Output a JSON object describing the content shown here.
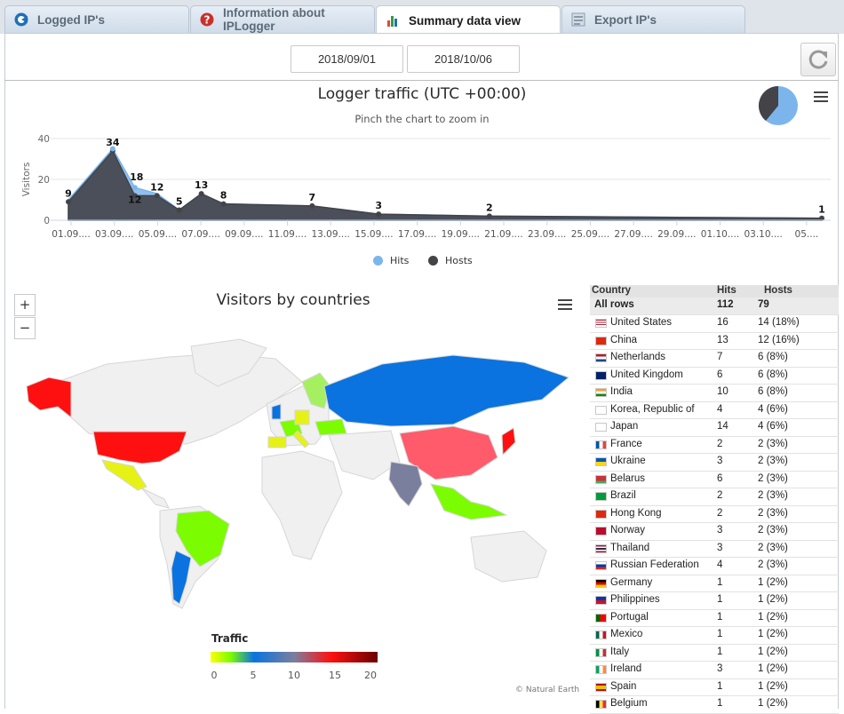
{
  "tabs": [
    {
      "label": "Logged IP's",
      "icon": "logged-ips-icon"
    },
    {
      "label": "Information about IPLogger",
      "icon": "info-icon"
    },
    {
      "label": "Summary data view",
      "icon": "bar-chart-icon"
    },
    {
      "label": "Export IP's",
      "icon": "export-icon"
    }
  ],
  "dates": {
    "from": "2018/09/01",
    "to": "2018/10/06"
  },
  "traffic": {
    "title": "Logger traffic (UTC +00:00)",
    "subtitle": "Pinch the chart to zoom in",
    "ylabel": "Visitors",
    "legend": [
      {
        "name": "Hits",
        "color": "#7cb5ec"
      },
      {
        "name": "Hosts",
        "color": "#434348"
      }
    ]
  },
  "chart_data": {
    "type": "area",
    "title": "Logger traffic (UTC +00:00)",
    "subtitle": "Pinch the chart to zoom in",
    "ylabel": "Visitors",
    "ylim": [
      0,
      40
    ],
    "yticks": [
      0,
      20,
      40
    ],
    "xticks": [
      "01.09....",
      "03.09....",
      "05.09....",
      "07.09....",
      "09.09....",
      "11.09....",
      "13.09....",
      "15.09....",
      "17.09....",
      "19.09....",
      "21.09....",
      "23.09....",
      "25.09....",
      "27.09....",
      "29.09....",
      "01.10....",
      "03.10....",
      "05...."
    ],
    "x": [
      1,
      3,
      4,
      5,
      6,
      7,
      8,
      12,
      15,
      20,
      35
    ],
    "series": [
      {
        "name": "Hits",
        "color": "#7cb5ec",
        "values": [
          10,
          35,
          16,
          13,
          5,
          13,
          8,
          7,
          3,
          2,
          1
        ]
      },
      {
        "name": "Hosts",
        "color": "#434348",
        "values": [
          9,
          34,
          12,
          12,
          5,
          13,
          8,
          7,
          3,
          2,
          1
        ]
      }
    ],
    "point_labels": [
      {
        "x": 1,
        "text": "9"
      },
      {
        "x": 3,
        "text": "34"
      },
      {
        "x": 4,
        "text": "18"
      },
      {
        "x": 4,
        "text": "12"
      },
      {
        "x": 5,
        "text": "12"
      },
      {
        "x": 6,
        "text": "5"
      },
      {
        "x": 7,
        "text": "13"
      },
      {
        "x": 8,
        "text": "8"
      },
      {
        "x": 12,
        "text": "7"
      },
      {
        "x": 15,
        "text": "3"
      },
      {
        "x": 20,
        "text": "2"
      },
      {
        "x": 35,
        "text": "1"
      }
    ],
    "legend": "bottom"
  },
  "map": {
    "title": "Visitors by countries",
    "scale_title": "Traffic",
    "scale_ticks": [
      "0",
      "5",
      "10",
      "15",
      "20"
    ],
    "credit": "© Natural Earth",
    "zoom_in": "+",
    "zoom_out": "−"
  },
  "table": {
    "headers": [
      "Country",
      "Hits",
      "Hosts"
    ],
    "total": {
      "label": "All rows",
      "hits": "112",
      "hosts": "79"
    },
    "rows": [
      {
        "country": "United States",
        "hits": "16",
        "hosts": "14 (18%)",
        "flag": "us"
      },
      {
        "country": "China",
        "hits": "13",
        "hosts": "12 (16%)",
        "flag": "cn"
      },
      {
        "country": "Netherlands",
        "hits": "7",
        "hosts": "6 (8%)",
        "flag": "nl"
      },
      {
        "country": "United Kingdom",
        "hits": "6",
        "hosts": "6 (8%)",
        "flag": "gb"
      },
      {
        "country": "India",
        "hits": "10",
        "hosts": "6 (8%)",
        "flag": "in"
      },
      {
        "country": "Korea, Republic of",
        "hits": "4",
        "hosts": "4 (6%)",
        "flag": "kr"
      },
      {
        "country": "Japan",
        "hits": "14",
        "hosts": "4 (6%)",
        "flag": "jp"
      },
      {
        "country": "France",
        "hits": "2",
        "hosts": "2 (3%)",
        "flag": "fr"
      },
      {
        "country": "Ukraine",
        "hits": "3",
        "hosts": "2 (3%)",
        "flag": "ua"
      },
      {
        "country": "Belarus",
        "hits": "6",
        "hosts": "2 (3%)",
        "flag": "by"
      },
      {
        "country": "Brazil",
        "hits": "2",
        "hosts": "2 (3%)",
        "flag": "br"
      },
      {
        "country": "Hong Kong",
        "hits": "2",
        "hosts": "2 (3%)",
        "flag": "hk"
      },
      {
        "country": "Norway",
        "hits": "3",
        "hosts": "2 (3%)",
        "flag": "no"
      },
      {
        "country": "Thailand",
        "hits": "3",
        "hosts": "2 (3%)",
        "flag": "th"
      },
      {
        "country": "Russian Federation",
        "hits": "4",
        "hosts": "2 (3%)",
        "flag": "ru"
      },
      {
        "country": "Germany",
        "hits": "1",
        "hosts": "1 (2%)",
        "flag": "de"
      },
      {
        "country": "Philippines",
        "hits": "1",
        "hosts": "1 (2%)",
        "flag": "ph"
      },
      {
        "country": "Portugal",
        "hits": "1",
        "hosts": "1 (2%)",
        "flag": "pt"
      },
      {
        "country": "Mexico",
        "hits": "1",
        "hosts": "1 (2%)",
        "flag": "mx"
      },
      {
        "country": "Italy",
        "hits": "1",
        "hosts": "1 (2%)",
        "flag": "it"
      },
      {
        "country": "Ireland",
        "hits": "3",
        "hosts": "1 (2%)",
        "flag": "ie"
      },
      {
        "country": "Spain",
        "hits": "1",
        "hosts": "1 (2%)",
        "flag": "es"
      },
      {
        "country": "Belgium",
        "hits": "1",
        "hosts": "1 (2%)",
        "flag": "be"
      }
    ]
  },
  "colors": {
    "hits": "#7cb5ec",
    "hosts": "#434348",
    "us": "#ff1010",
    "green": "#7cfc00",
    "blue": "#0a73e0"
  }
}
